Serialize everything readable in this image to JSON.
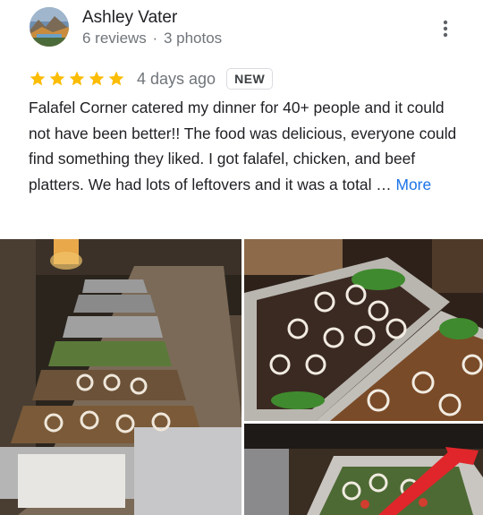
{
  "reviewer": {
    "name": "Ashley Vater",
    "reviews": "6 reviews",
    "separator": "·",
    "photos": "3 photos"
  },
  "review": {
    "rating": 5,
    "time": "4 days ago",
    "badge": "NEW",
    "text": "Falafel Corner catered my dinner for 40+ people and it could not have been better!! The food was delicious, everyone could find something they liked. I got falafel, chicken, and beef platters. We had lots of leftovers and it was a total …",
    "more_label": "More"
  },
  "colors": {
    "star": "#fbbc04",
    "link": "#1a73e8",
    "secondary_text": "#70757a"
  },
  "icons": {
    "menu": "more-vert-icon",
    "star": "star-icon"
  }
}
